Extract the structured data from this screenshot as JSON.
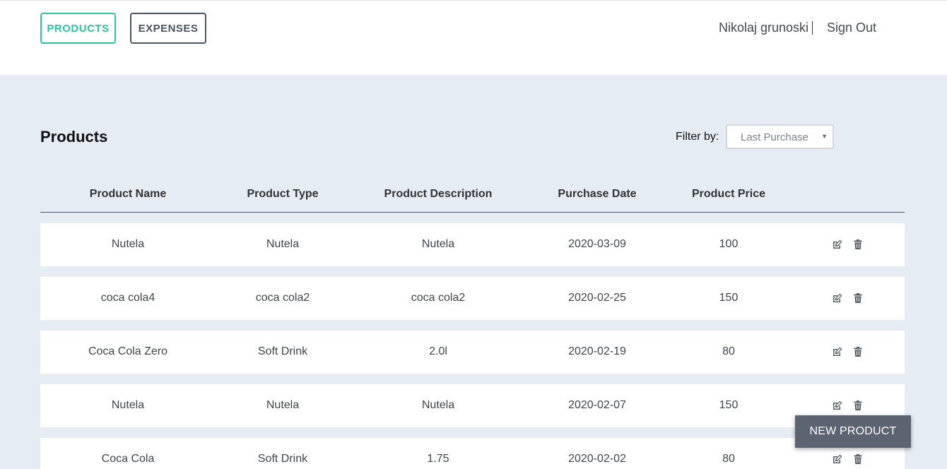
{
  "nav": {
    "products_label": "PRODUCTS",
    "expenses_label": "EXPENSES",
    "user_name": "Nikolaj grunoski",
    "signout_label": "Sign Out"
  },
  "page": {
    "title": "Products",
    "filter_label": "Filter by:",
    "filter_value": "Last Purchase"
  },
  "table": {
    "headers": [
      "Product Name",
      "Product Type",
      "Product Description",
      "Purchase Date",
      "Product Price"
    ],
    "rows": [
      [
        "Nutela",
        "Nutela",
        "Nutela",
        "2020-03-09",
        "100"
      ],
      [
        "coca cola4",
        "coca cola2",
        "coca cola2",
        "2020-02-25",
        "150"
      ],
      [
        "Coca Cola Zero",
        "Soft Drink",
        "2.0l",
        "2020-02-19",
        "80"
      ],
      [
        "Nutela",
        "Nutela",
        "Nutela",
        "2020-02-07",
        "150"
      ],
      [
        "Coca Cola",
        "Soft Drink",
        "1.75",
        "2020-02-02",
        "80"
      ]
    ]
  },
  "actions": {
    "new_product_label": "NEW PRODUCT"
  },
  "colors": {
    "accent": "#2ec4a0",
    "dark": "#4a5563",
    "background": "#e5ecf4",
    "button": "#5b6470"
  },
  "icons": {
    "edit": "edit-icon",
    "delete": "trash-icon"
  }
}
